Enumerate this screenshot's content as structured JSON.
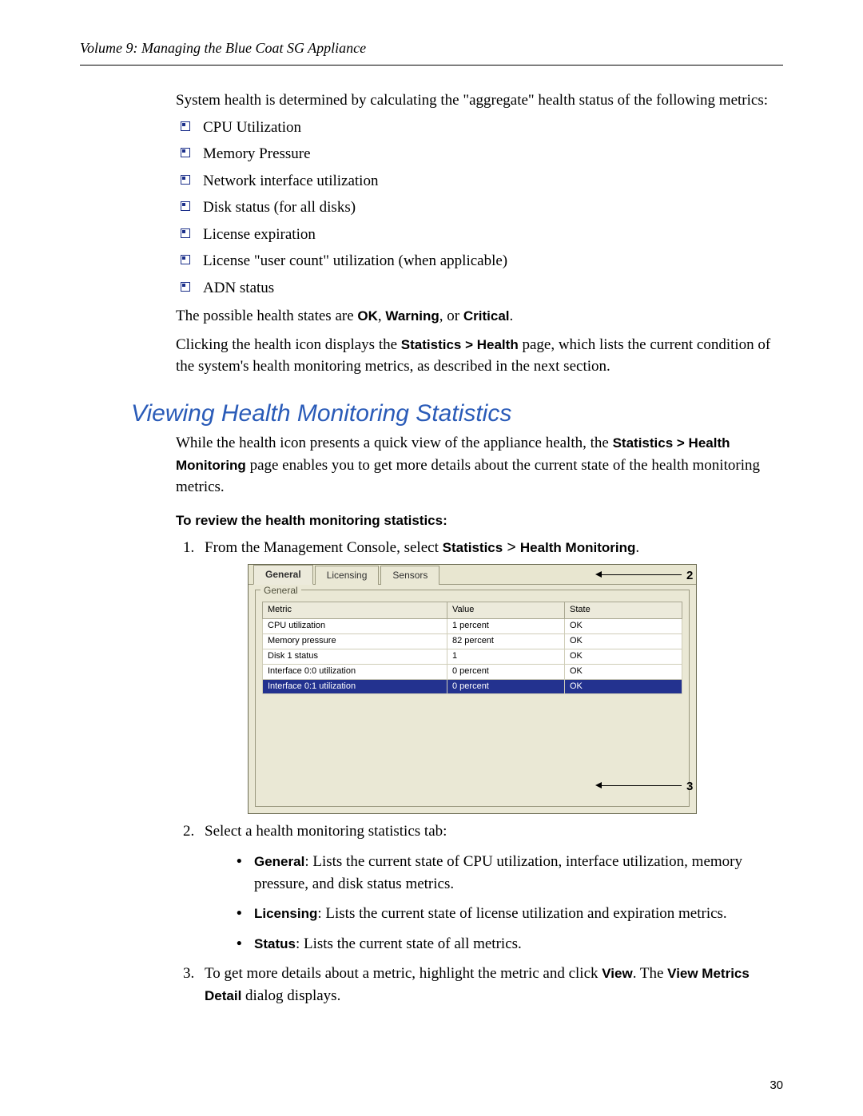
{
  "header": {
    "running": "Volume 9: Managing the Blue Coat SG Appliance"
  },
  "intro": "System health is determined by calculating the \"aggregate\" health status of the following metrics:",
  "metrics_list": [
    "CPU Utilization",
    "Memory Pressure",
    "Network interface utilization",
    "Disk status (for all disks)",
    "License expiration",
    "License \"user count\" utilization (when applicable)",
    "ADN status"
  ],
  "states_sentence": {
    "pre": "The possible health states are ",
    "s1": "OK",
    "c1": ", ",
    "s2": "Warning",
    "c2": ", or ",
    "s3": "Critical",
    "c3": "."
  },
  "click_sentence": {
    "pre": "Clicking the health icon displays the ",
    "bold": "Statistics > Health",
    "post": " page, which lists the current condition of the system's health monitoring metrics, as described in the next section."
  },
  "section_title": "Viewing Health Monitoring Statistics",
  "section_intro": {
    "pre": "While the health icon presents a quick view of the appliance health, the ",
    "bold": "Statistics > Health Monitoring",
    "post": " page enables you to get more details about the current state of the health monitoring metrics."
  },
  "sub_head": "To review the health monitoring statistics:",
  "step1": {
    "pre": "From the Management Console, select ",
    "b1": "Statistics",
    "gt": " > ",
    "b2": "Health Monitoring",
    "post": "."
  },
  "figure": {
    "tabs": [
      "General",
      "Licensing",
      "Sensors"
    ],
    "legend": "General",
    "columns": [
      "Metric",
      "Value",
      "State"
    ],
    "rows": [
      {
        "metric": "CPU utilization",
        "value": "1 percent",
        "state": "OK",
        "selected": false
      },
      {
        "metric": "Memory pressure",
        "value": "82 percent",
        "state": "OK",
        "selected": false
      },
      {
        "metric": "Disk 1 status",
        "value": "1",
        "state": "OK",
        "selected": false
      },
      {
        "metric": "Interface 0:0 utilization",
        "value": "0 percent",
        "state": "OK",
        "selected": false
      },
      {
        "metric": "Interface 0:1 utilization",
        "value": "0 percent",
        "state": "OK",
        "selected": true
      }
    ],
    "callouts": {
      "top": "2",
      "bottom": "3"
    }
  },
  "step2": {
    "lead": "Select a health monitoring statistics tab:",
    "items": [
      {
        "label": "General",
        "desc": ": Lists the current state of CPU utilization, interface utilization, memory pressure, and disk status metrics."
      },
      {
        "label": "Licensing",
        "desc": ": Lists the current state of license utilization and expiration metrics."
      },
      {
        "label": "Status",
        "desc": ": Lists the current state of all metrics."
      }
    ]
  },
  "step3": {
    "pre": "To get more details about a metric, highlight the metric and click ",
    "b1": "View",
    "mid": ". The ",
    "b2": "View Metrics Detail",
    "post": " dialog displays."
  },
  "page_number": "30",
  "chart_data": {
    "type": "table",
    "title": "General – Health Monitoring Statistics",
    "columns": [
      "Metric",
      "Value",
      "State"
    ],
    "rows": [
      [
        "CPU utilization",
        "1 percent",
        "OK"
      ],
      [
        "Memory pressure",
        "82 percent",
        "OK"
      ],
      [
        "Disk 1 status",
        "1",
        "OK"
      ],
      [
        "Interface 0:0 utilization",
        "0 percent",
        "OK"
      ],
      [
        "Interface 0:1 utilization",
        "0 percent",
        "OK"
      ]
    ]
  }
}
